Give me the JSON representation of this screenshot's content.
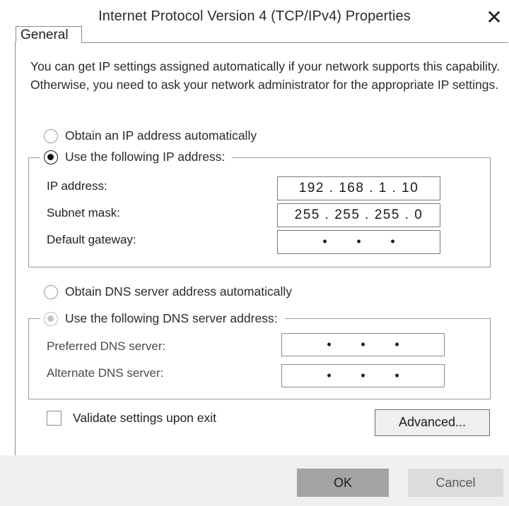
{
  "window": {
    "title": "Internet Protocol Version 4 (TCP/IPv4) Properties",
    "close_glyph": "✕"
  },
  "tab": {
    "label": "General"
  },
  "intro_text": "You can get IP settings assigned automatically if your network supports this capability. Otherwise, you need to ask your network administrator for the appropriate IP settings.",
  "ip_section": {
    "auto_label": "Obtain an IP address automatically",
    "auto_selected": false,
    "manual_label": "Use the following IP address:",
    "manual_selected": true,
    "fields": [
      {
        "label": "IP address:",
        "value": "192 . 168 . 1 . 10"
      },
      {
        "label": "Subnet mask:",
        "value": "255 . 255 . 255 . 0"
      },
      {
        "label": "Default gateway:",
        "value": ""
      }
    ]
  },
  "dns_section": {
    "auto_label": "Obtain DNS server address automatically",
    "auto_selected": false,
    "manual_label": "Use the following DNS server address:",
    "manual_selected": true,
    "manual_disabled": true,
    "fields": [
      {
        "label": "Preferred DNS server:",
        "value": ""
      },
      {
        "label": "Alternate DNS server:",
        "value": ""
      }
    ]
  },
  "validate_checkbox": {
    "label": "Validate settings upon exit",
    "checked": false
  },
  "buttons": {
    "advanced": "Advanced...",
    "ok": "OK",
    "cancel": "Cancel"
  },
  "empty_ip_separator": "•"
}
